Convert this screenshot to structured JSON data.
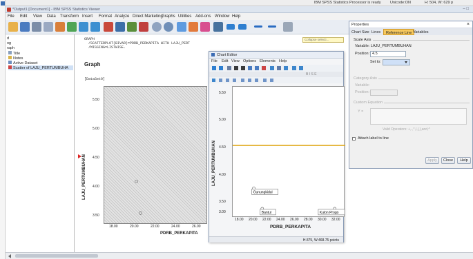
{
  "statusbar": {
    "processor": "IBM SPSS Statistics Processor is ready",
    "unicode": "Unicode:ON",
    "size": "H: 504, W: 629 p"
  },
  "window": {
    "title": "*Output1 [Document1] - IBM SPSS Statistics Viewer",
    "controls": "–   □"
  },
  "menu": [
    "File",
    "Edit",
    "View",
    "Data",
    "Transform",
    "Insert",
    "Format",
    "Analyze",
    "Direct Marketing",
    "Graphs",
    "Utilities",
    "Add-ons",
    "Window",
    "Help"
  ],
  "nav": {
    "items": [
      "d",
      "og",
      "raph",
      "Title",
      "Notes",
      "Active Dataset",
      "Scatter of LAJU_PERTUMBUHA"
    ]
  },
  "output": {
    "syntax": [
      "GRAPH",
      "  /SCATTERPLOT(BIVAR)=PDRB_PERKAPITA WITH LAJU_PERT",
      "  /MISSING=LISTWISE."
    ],
    "heading": "Graph",
    "dataset": "[DataSet0]",
    "yaxis": "LAJU_PERTUMBUHAN",
    "xaxis": "PDRB_PERKAPITA",
    "yticks": [
      "5.50",
      "5.00",
      "4.50",
      "4.00",
      "3.50"
    ],
    "xticks": [
      "18.00",
      "20.00",
      "22.00",
      "24.00",
      "26.00"
    ]
  },
  "collapse": "Collapse selecti...",
  "chart_editor": {
    "title": "Chart Editor",
    "menu": [
      "File",
      "Edit",
      "View",
      "Options",
      "Elements",
      "Help"
    ],
    "font_hint": "B  I  S  E",
    "yaxis": "LAJU_PERTUMBUHAN",
    "xaxis": "PDRB_PERKAPITA",
    "yticks": [
      "5.50",
      "5.00",
      "4.50",
      "4.00",
      "3.50",
      "3.00"
    ],
    "xticks": [
      "18.00",
      "20.00",
      "22.00",
      "24.00",
      "26.00",
      "28.00",
      "30.00",
      "32.00"
    ],
    "labels": [
      "Gunungkidul",
      "Bantul",
      "Kulon Progo"
    ],
    "status": "H:375, W:468.75 points"
  },
  "properties": {
    "title": "Properties",
    "close": "×",
    "tabs": [
      "Chart Size",
      "Lines",
      "Reference Line",
      "Variables"
    ],
    "scale_axis": "Scale Axis",
    "variable": "Variable:  LAJU_PERTUMBUHAN",
    "position_label": "Position:",
    "position_value": "4.5",
    "set_to_label": "Set to:",
    "category_axis": "Category Axis",
    "cat_variable": "Variable:",
    "cat_position": "Position:",
    "custom_equation": "Custom Equation",
    "eq_symbol": "Y =",
    "valid_ops": "Valid Operators: +,-,*,/,(,),and,^",
    "attach": "Attach label to line",
    "buttons": {
      "apply": "Apply",
      "close": "Close",
      "help": "Help"
    }
  },
  "chart_data": [
    {
      "type": "scatter",
      "title": "",
      "xlabel": "PDRB_PERKAPITA",
      "ylabel": "LAJU_PERTUMBUHAN",
      "xlim": [
        17,
        27
      ],
      "ylim": [
        3.2,
        5.6
      ],
      "x": [
        20.1,
        20.5
      ],
      "y": [
        3.95,
        3.4
      ]
    },
    {
      "type": "scatter",
      "title": "",
      "xlabel": "PDRB_PERKAPITA",
      "ylabel": "LAJU_PERTUMBUHAN",
      "xlim": [
        17,
        33
      ],
      "ylim": [
        2.9,
        5.8
      ],
      "x": [
        20.0,
        21.2,
        31.5
      ],
      "y": [
        3.55,
        3.1,
        3.1
      ],
      "point_labels": [
        "Gunungkidul",
        "Bantul",
        "Kulon Progo"
      ],
      "reference_line": {
        "y": 4.5
      }
    }
  ]
}
